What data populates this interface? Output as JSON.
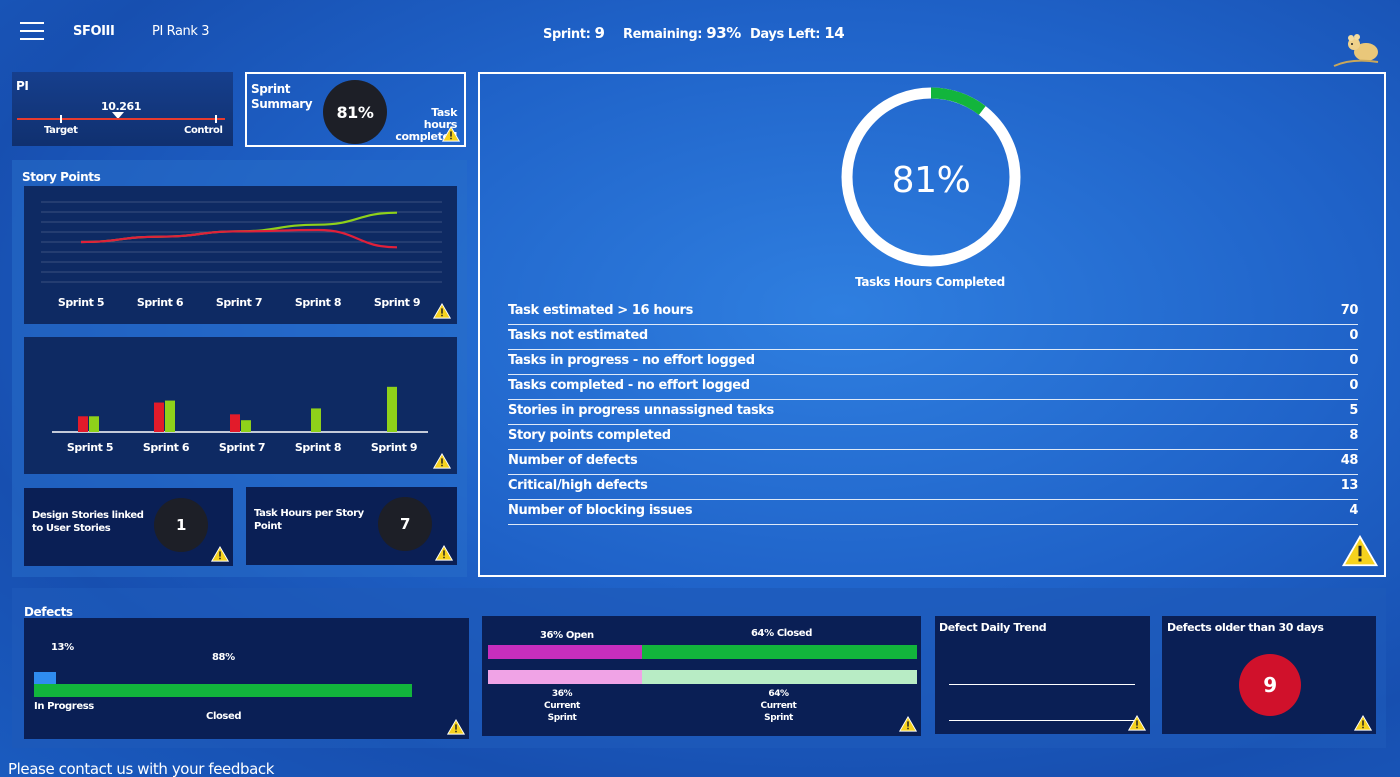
{
  "header": {
    "team": "SFOIII",
    "pi_rank": "PI Rank 3",
    "sprint_label": "Sprint:",
    "sprint_value": "9",
    "remaining_label": "Remaining:",
    "remaining_value": "93%",
    "days_left_label": "Days Left:",
    "days_left_value": "14"
  },
  "pi": {
    "title": "PI",
    "value": "10.261",
    "target_label": "Target",
    "control_label": "Control"
  },
  "sprint_summary": {
    "title_line1": "Sprint",
    "title_line2": "Summary",
    "percent": "81%",
    "caption_line1": "Task hours",
    "caption_line2": "completed"
  },
  "story_points": {
    "title": "Story Points",
    "line_chart": {
      "type": "line",
      "categories": [
        "Sprint 5",
        "Sprint 6",
        "Sprint 7",
        "Sprint 8",
        "Sprint 9"
      ],
      "series": [
        {
          "color": "#8fd11a",
          "values": [
            3.0,
            3.4,
            3.8,
            4.3,
            5.2
          ]
        },
        {
          "color": "#e0203a",
          "values": [
            3.0,
            3.4,
            3.8,
            3.9,
            2.6
          ]
        }
      ],
      "ylim": [
        0,
        6
      ]
    },
    "bar_chart": {
      "type": "bar",
      "categories": [
        "Sprint 5",
        "Sprint 6",
        "Sprint 7",
        "Sprint 8",
        "Sprint 9"
      ],
      "series": [
        {
          "color": "#e21b2a",
          "values": [
            8,
            15,
            9,
            0,
            0
          ]
        },
        {
          "color": "#8fd11a",
          "values": [
            8,
            16,
            6,
            12,
            23
          ]
        }
      ],
      "ylim": [
        0,
        28
      ]
    }
  },
  "design_stories": {
    "label_line1": "Design Stories linked",
    "label_line2": "to User Stories",
    "value": "1"
  },
  "task_hours_per_sp": {
    "label_line1": "Task Hours per Story",
    "label_line2": "Point",
    "value": "7"
  },
  "main": {
    "donut_percent": "81%",
    "donut_value": 0.81,
    "donut_caption": "Tasks Hours Completed",
    "metrics": [
      {
        "label": "Task estimated > 16 hours",
        "value": "70"
      },
      {
        "label": "Tasks not estimated",
        "value": "0"
      },
      {
        "label": "Tasks in progress - no effort logged",
        "value": "0"
      },
      {
        "label": "Tasks completed - no effort logged",
        "value": "0"
      },
      {
        "label": "Stories in progress unnassigned tasks",
        "value": "5"
      },
      {
        "label": "Story points completed",
        "value": "8"
      },
      {
        "label": "Number of defects",
        "value": "48"
      },
      {
        "label": "Critical/high defects",
        "value": "13"
      },
      {
        "label": "Number of blocking issues",
        "value": "4"
      }
    ]
  },
  "defects": {
    "title": "Defects",
    "in_progress_pct": "13%",
    "in_progress_value": 0.13,
    "in_progress_label": "In Progress",
    "closed_pct": "88%",
    "closed_value": 0.88,
    "closed_label": "Closed"
  },
  "open_closed": {
    "open_label": "36% Open",
    "closed_label": "64% Closed",
    "open_value": 0.36,
    "current_open_pct": "36%",
    "current_open_label": "Current Sprint",
    "current_closed_pct": "64%",
    "current_closed_label": "Current Sprint"
  },
  "defect_daily_trend": {
    "title": "Defect Daily Trend"
  },
  "defects_older": {
    "title": "Defects older than 30 days",
    "value": "9"
  },
  "footer": {
    "feedback": "Please contact us with your feedback"
  },
  "colors": {
    "green": "#12b53c",
    "lime": "#8fd11a",
    "red": "#e21b2a",
    "magenta": "#c72ebd",
    "pink": "#f0a3e6",
    "mint": "#b8ecc5",
    "blue_bar": "#2f8cf0"
  }
}
